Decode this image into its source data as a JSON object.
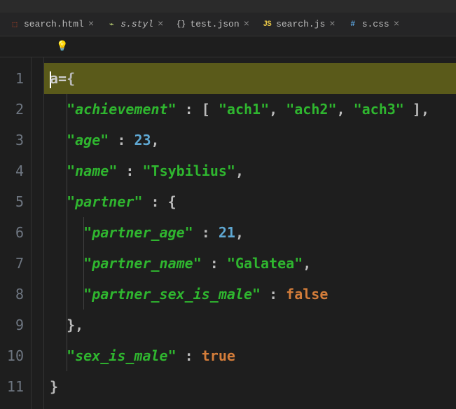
{
  "tabs": [
    {
      "icon": "html",
      "label": "search.html",
      "active": false
    },
    {
      "icon": "styl",
      "label": "s.styl",
      "active": false
    },
    {
      "icon": "json",
      "label": "test.json",
      "active": false
    },
    {
      "icon": "js",
      "label": "search.js",
      "active": true
    },
    {
      "icon": "css",
      "label": "s.css",
      "active": false
    }
  ],
  "icon_glyphs": {
    "html": "⬚",
    "styl": "⌁",
    "json": "{}",
    "js": "JS",
    "css": "#"
  },
  "close_glyph": "×",
  "bulb_glyph": "💡",
  "line_count": 11,
  "code": {
    "var": "a",
    "eq": "=",
    "brace_open": "{",
    "brace_close": "}",
    "bracket_open": "[",
    "bracket_close": "]",
    "comma": ",",
    "colon": " : ",
    "quote": "\"",
    "keys": {
      "achievement": "achievement",
      "age": "age",
      "name": "name",
      "partner": "partner",
      "partner_age": "partner_age",
      "partner_name": "partner_name",
      "partner_sex_is_male": "partner_sex_is_male",
      "sex_is_male": "sex_is_male"
    },
    "vals": {
      "ach1": "ach1",
      "ach2": "ach2",
      "ach3": "ach3",
      "age": "23",
      "name": "Tsybilius",
      "partner_age": "21",
      "partner_name": "Galatea",
      "false": "false",
      "true": "true"
    }
  }
}
